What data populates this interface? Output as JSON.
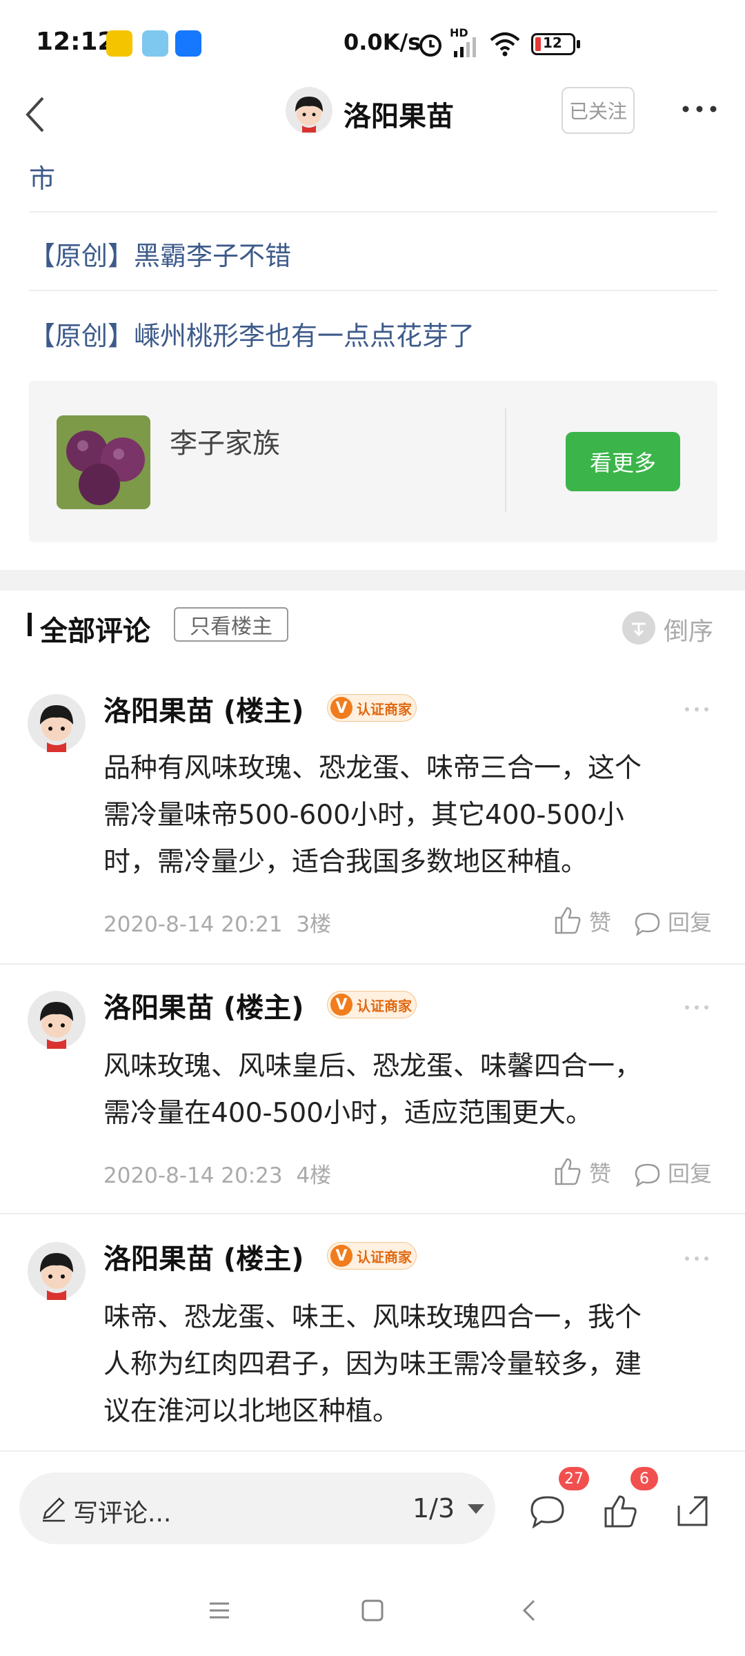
{
  "status_bar": {
    "time": "12:12",
    "network_speed": "0.0K/s",
    "battery": "12",
    "hd_label": "HD"
  },
  "header": {
    "title": "洛阳果苗",
    "follow_label": "已关注"
  },
  "related": {
    "truncated_line": "市",
    "links": [
      "【原创】黑霸李子不错",
      "【原创】嵊州桃形李也有一点点花芽了"
    ]
  },
  "recommend_card": {
    "title": "李子家族",
    "button_label": "看更多"
  },
  "comments_section": {
    "title": "全部评论",
    "filter_label": "只看楼主",
    "sort_label": "倒序"
  },
  "comments": [
    {
      "author": "洛阳果苗 (楼主)",
      "badge": "认证商家",
      "lines": [
        "品种有风味玫瑰、恐龙蛋、味帝三合一，这个",
        "需冷量味帝500-600小时，其它400-500小",
        "时，需冷量少，适合我国多数地区种植。"
      ],
      "timestamp": "2020-8-14 20:21",
      "floor": "3楼",
      "like_label": "赞",
      "reply_label": "回复"
    },
    {
      "author": "洛阳果苗 (楼主)",
      "badge": "认证商家",
      "lines": [
        "风味玫瑰、风味皇后、恐龙蛋、味馨四合一，",
        "需冷量在400-500小时，适应范围更大。"
      ],
      "timestamp": "2020-8-14 20:23",
      "floor": "4楼",
      "like_label": "赞",
      "reply_label": "回复"
    },
    {
      "author": "洛阳果苗 (楼主)",
      "badge": "认证商家",
      "lines": [
        "味帝、恐龙蛋、味王、风味玫瑰四合一，我个",
        "人称为红肉四君子，因为味王需冷量较多，建",
        "议在淮河以北地区种植。"
      ]
    }
  ],
  "bottom_bar": {
    "write_placeholder": "写评论...",
    "page_indicator": "1/3",
    "comment_count": "27",
    "like_count": "6"
  },
  "colors": {
    "link": "#3d5a8a",
    "button_green": "#3bb54a",
    "badge_orange": "#f07c1c",
    "count_red": "#f24f4f"
  }
}
